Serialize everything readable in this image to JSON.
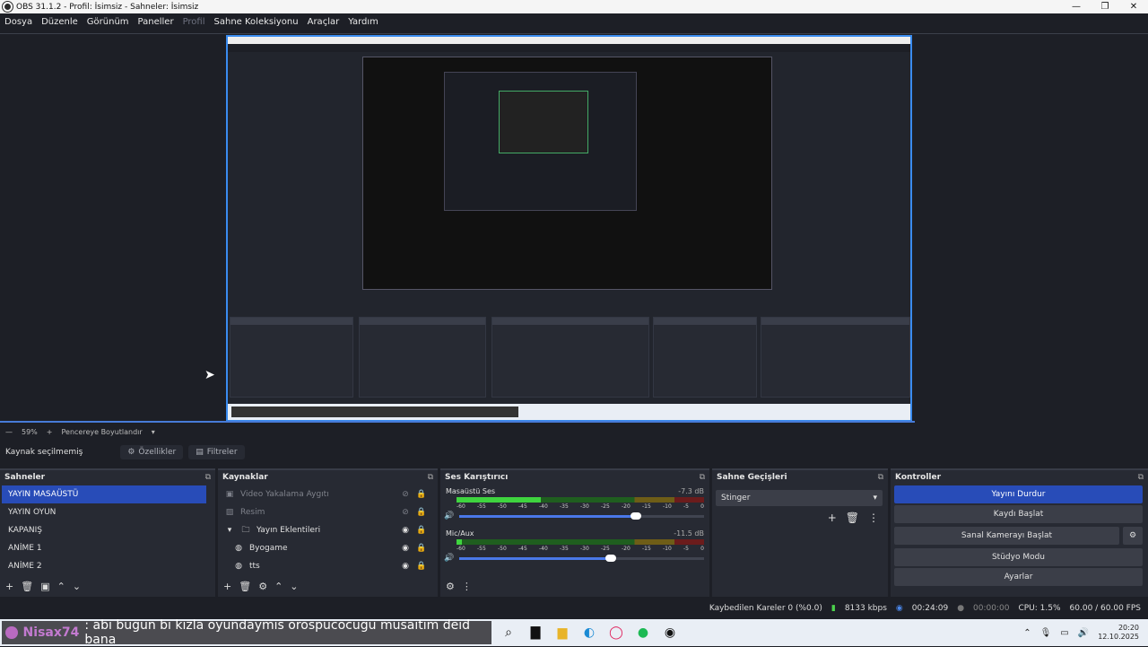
{
  "window": {
    "title": "OBS 31.1.2 - Profil: İsimsiz - Sahneler: İsimsiz"
  },
  "menu": [
    "Dosya",
    "Düzenle",
    "Görünüm",
    "Paneller",
    "Profil",
    "Sahne Koleksiyonu",
    "Araçlar",
    "Yardım"
  ],
  "zoom": {
    "value": "59%",
    "mode": "Pencereye Boyutlandır"
  },
  "source_bar": {
    "label": "Kaynak seçilmemiş",
    "properties": "Özellikler",
    "filters": "Filtreler"
  },
  "scenes": {
    "title": "Sahneler",
    "items": [
      "YAYIN MASAÜSTÜ",
      "YAYIN OYUN",
      "KAPANIŞ",
      "ANİME 1",
      "ANİME 2"
    ],
    "selected": 0
  },
  "sources": {
    "title": "Kaynaklar",
    "items": [
      {
        "name": "Video Yakalama Aygıtı",
        "dim": true
      },
      {
        "name": "Resim",
        "dim": true
      },
      {
        "name": "Yayın Eklentileri",
        "dim": false
      },
      {
        "name": "Byogame",
        "dim": false
      },
      {
        "name": "tts",
        "dim": false
      }
    ]
  },
  "mixer": {
    "title": "Ses Karıştırıcı",
    "channels": [
      {
        "name": "Masaüstü Ses",
        "db": "-7.3 dB",
        "level": 0.34,
        "volume": 0.72
      },
      {
        "name": "Mic/Aux",
        "db": "-11.5 dB",
        "level": 0.02,
        "volume": 0.62
      }
    ],
    "scale": [
      "-60",
      "-55",
      "-50",
      "-45",
      "-40",
      "-35",
      "-30",
      "-25",
      "-20",
      "-15",
      "-10",
      "-5",
      "0"
    ]
  },
  "transitions": {
    "title": "Sahne Geçişleri",
    "selected": "Stinger"
  },
  "controls": {
    "title": "Kontroller",
    "buttons": [
      "Yayını Durdur",
      "Kaydı Başlat",
      "Sanal Kamerayı Başlat",
      "Stüdyo Modu",
      "Ayarlar"
    ]
  },
  "status": {
    "dropped": "Kaybedilen Kareler 0 (%0.0)",
    "bitrate": "8133 kbps",
    "stream_time": "00:24:09",
    "rec_time": "00:00:00",
    "cpu": "CPU: 1.5%",
    "fps": "60.00 / 60.00 FPS"
  },
  "taskbar": {
    "chat_user": "Nisax74",
    "chat_message": ": abı bugun bı kızla oyundaymıs orospucocugu musaıtım deıd bana",
    "time": "20:20",
    "date": "12.10.2025"
  },
  "accent_color": "#284cb8"
}
